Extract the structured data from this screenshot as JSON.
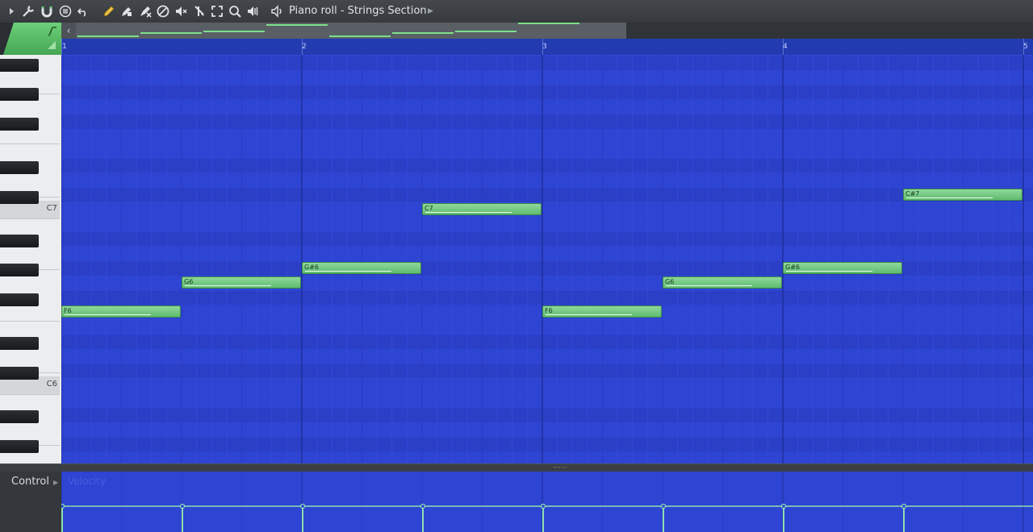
{
  "toolbar": {
    "title": "Piano roll - Strings Section",
    "icons": [
      "play-arrow-icon",
      "wrench-icon",
      "magnet-icon",
      "menu-icon",
      "undo-icon",
      "pencil-icon",
      "paint-icon",
      "delete-icon",
      "mute-icon",
      "slice-icon",
      "select-icon",
      "zoom-icon",
      "playback-icon",
      "speaker-icon"
    ]
  },
  "ruler": {
    "bars": [
      "1",
      "2",
      "3",
      "4",
      "5"
    ]
  },
  "keys": {
    "c7": "C7",
    "c6": "C6"
  },
  "notes": [
    {
      "pitch": "F6",
      "start": 1.0,
      "length": 0.5
    },
    {
      "pitch": "G6",
      "start": 1.5,
      "length": 0.5
    },
    {
      "pitch": "G#6",
      "start": 2.0,
      "length": 0.5
    },
    {
      "pitch": "C7",
      "start": 2.5,
      "length": 0.5
    },
    {
      "pitch": "F6",
      "start": 3.0,
      "length": 0.5
    },
    {
      "pitch": "G6",
      "start": 3.5,
      "length": 0.5
    },
    {
      "pitch": "G#6",
      "start": 4.0,
      "length": 0.5
    },
    {
      "pitch": "C#7",
      "start": 4.5,
      "length": 0.5
    }
  ],
  "control": {
    "label": "Control",
    "parameter": "Velocity"
  },
  "colors": {
    "grid": "#2e44d2",
    "note": "#6fc47e",
    "accent": "#57c066"
  }
}
